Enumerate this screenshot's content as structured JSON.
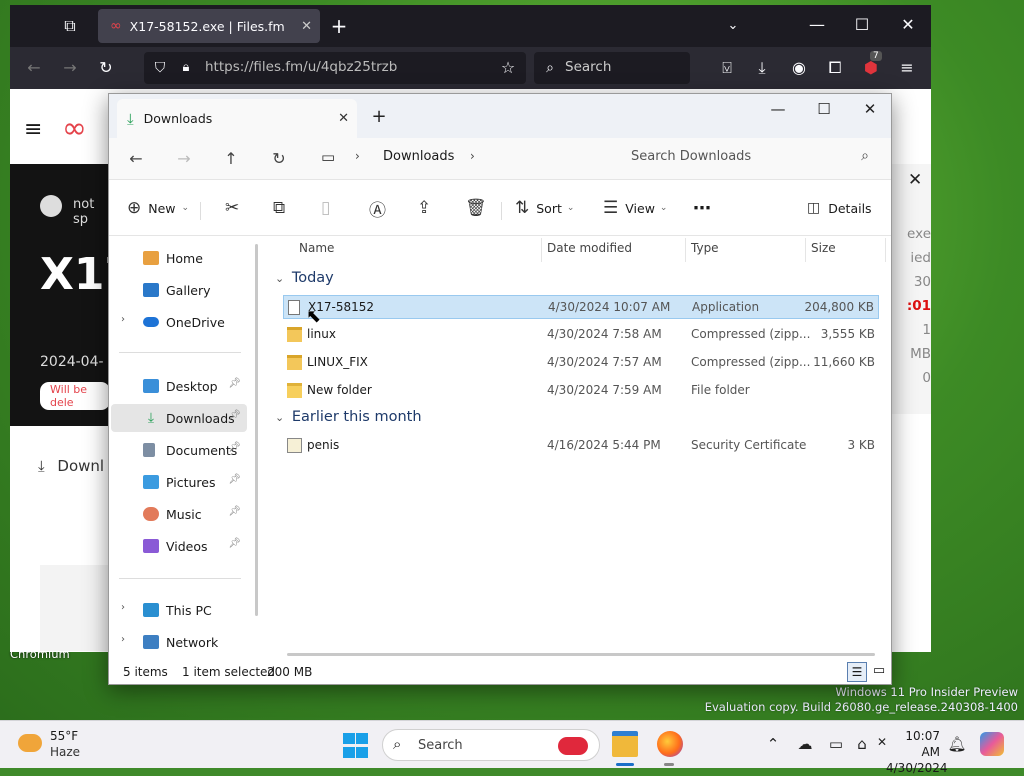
{
  "browser": {
    "tab_title": "X17-58152.exe | Files.fm",
    "url": "https://files.fm/u/4qbz25trzb",
    "search_placeholder": "Search",
    "ext_badge": "7"
  },
  "webpage": {
    "user_text": "not sp",
    "title_fragment": "X17",
    "date_fragment": "2024-04-",
    "delete_notice": "Will be dele",
    "download_label": "Downl",
    "right_col": [
      "exe",
      "ied",
      "30",
      ":01",
      "1",
      "MB",
      "0"
    ]
  },
  "explorer": {
    "tab_title": "Downloads",
    "address": {
      "root_icon": "monitor-icon",
      "crumb": "Downloads",
      "search_placeholder": "Search Downloads"
    },
    "commands": {
      "new": "New",
      "sort": "Sort",
      "view": "View",
      "details": "Details"
    },
    "nav": {
      "top": [
        {
          "label": "Home",
          "color": "#e8a040"
        },
        {
          "label": "Gallery",
          "color": "#2a78c9"
        },
        {
          "label": "OneDrive",
          "color": "#1d73d6"
        }
      ],
      "pinned": [
        {
          "label": "Desktop",
          "color": "#3a8fd9"
        },
        {
          "label": "Downloads",
          "color": "#2aa15a"
        },
        {
          "label": "Documents",
          "color": "#7d8ea3"
        },
        {
          "label": "Pictures",
          "color": "#3b9be0"
        },
        {
          "label": "Music",
          "color": "#e27a5a"
        },
        {
          "label": "Videos",
          "color": "#8a5ad6"
        }
      ],
      "bottom": [
        {
          "label": "This PC",
          "color": "#2a8fd1"
        },
        {
          "label": "Network",
          "color": "#3d7fc2"
        }
      ]
    },
    "columns": {
      "name": "Name",
      "date": "Date modified",
      "type": "Type",
      "size": "Size"
    },
    "groups": [
      {
        "label": "Today",
        "files": [
          {
            "name": "X17-58152",
            "date": "4/30/2024 10:07 AM",
            "type": "Application",
            "size": "204,800 KB",
            "selected": true
          },
          {
            "name": "linux",
            "date": "4/30/2024 7:58 AM",
            "type": "Compressed (zipp...",
            "size": "3,555 KB"
          },
          {
            "name": "LINUX_FIX",
            "date": "4/30/2024 7:57 AM",
            "type": "Compressed (zipp...",
            "size": "11,660 KB"
          },
          {
            "name": "New folder",
            "date": "4/30/2024 7:59 AM",
            "type": "File folder",
            "size": ""
          }
        ]
      },
      {
        "label": "Earlier this month",
        "files": [
          {
            "name": "penis",
            "date": "4/16/2024 5:44 PM",
            "type": "Security Certificate",
            "size": "3 KB"
          }
        ]
      }
    ],
    "status": {
      "count": "5 items",
      "selected": "1 item selected",
      "size": "200 MB"
    }
  },
  "desktop": {
    "chromium_label": "Chromium",
    "watermark_line1": "Windows 11 Pro Insider Preview",
    "watermark_line2": "Evaluation copy. Build 26080.ge_release.240308-1400"
  },
  "taskbar": {
    "weather_temp": "55°F",
    "weather_desc": "Haze",
    "search_placeholder": "Search",
    "time": "10:07 AM",
    "date": "4/30/2024"
  }
}
